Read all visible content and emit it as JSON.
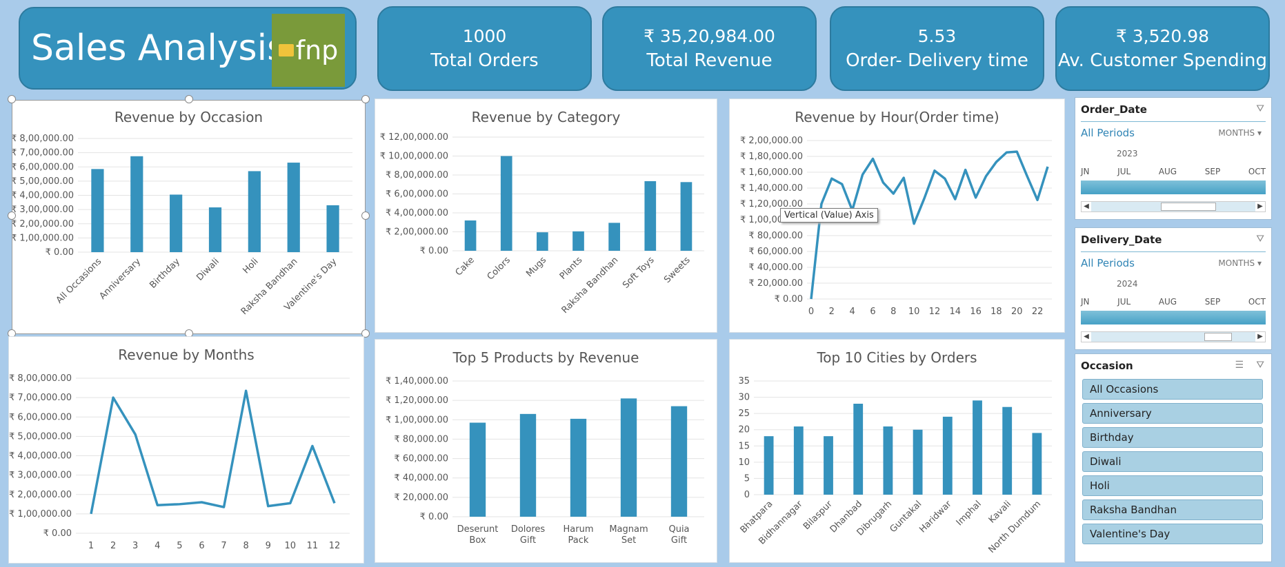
{
  "header": {
    "title": "Sales Analysis",
    "logo_text": "fnp"
  },
  "kpis": [
    {
      "value": "1000",
      "label": "Total Orders"
    },
    {
      "value": "₹ 35,20,984.00",
      "label": "Total Revenue"
    },
    {
      "value": "5.53",
      "label": "Order- Delivery time"
    },
    {
      "value": "₹ 3,520.98",
      "label": "Av. Customer Spending"
    }
  ],
  "tooltip": "Vertical (Value) Axis",
  "slicers": {
    "order_date": {
      "title": "Order_Date",
      "period": "All Periods",
      "unit": "MONTHS",
      "year": "2023",
      "months": [
        "JN",
        "JUL",
        "AUG",
        "SEP",
        "OCT"
      ]
    },
    "delivery_date": {
      "title": "Delivery_Date",
      "period": "All Periods",
      "unit": "MONTHS",
      "year": "2024",
      "months": [
        "JN",
        "JUL",
        "AUG",
        "SEP",
        "OCT"
      ]
    },
    "occasion": {
      "title": "Occasion",
      "items": [
        "All Occasions",
        "Anniversary",
        "Birthday",
        "Diwali",
        "Holi",
        "Raksha Bandhan",
        "Valentine's Day"
      ]
    }
  },
  "colors": {
    "accent": "#3592bd",
    "background": "#a9cbea"
  },
  "chart_data": [
    {
      "id": "occasion",
      "type": "bar",
      "title": "Revenue by Occasion",
      "categories": [
        "All Occasions",
        "Anniversary",
        "Birthday",
        "Diwali",
        "Holi",
        "Raksha Bandhan",
        "Valentine's Day"
      ],
      "values": [
        585000,
        675000,
        405000,
        315000,
        570000,
        630000,
        330000
      ],
      "ylim": [
        0,
        800000
      ],
      "yticks": [
        "₹ 0.00",
        "₹ 1,00,000.00",
        "₹ 2,00,000.00",
        "₹ 3,00,000.00",
        "₹ 4,00,000.00",
        "₹ 5,00,000.00",
        "₹ 6,00,000.00",
        "₹ 7,00,000.00",
        "₹ 8,00,000.00"
      ]
    },
    {
      "id": "category",
      "type": "bar",
      "title": "Revenue by Category",
      "categories": [
        "Cake",
        "Colors",
        "Mugs",
        "Plants",
        "Raksha Bandhan",
        "Soft Toys",
        "Sweets"
      ],
      "values": [
        320000,
        1000000,
        195000,
        205000,
        295000,
        735000,
        725000
      ],
      "ylim": [
        0,
        1200000
      ],
      "yticks": [
        "₹ 0.00",
        "₹ 2,00,000.00",
        "₹ 4,00,000.00",
        "₹ 6,00,000.00",
        "₹ 8,00,000.00",
        "₹ 10,00,000.00",
        "₹ 12,00,000.00"
      ]
    },
    {
      "id": "hour",
      "type": "line",
      "title": "Revenue by Hour(Order time)",
      "x": [
        0,
        1,
        2,
        3,
        4,
        5,
        6,
        7,
        8,
        9,
        10,
        11,
        12,
        13,
        14,
        15,
        16,
        17,
        18,
        19,
        20,
        21,
        22,
        23
      ],
      "values": [
        0,
        120000,
        152000,
        145000,
        112000,
        157000,
        177000,
        147000,
        133000,
        153000,
        95000,
        127000,
        162000,
        152000,
        126000,
        163000,
        128000,
        155000,
        173000,
        185000,
        186000,
        155000,
        125000,
        167000
      ],
      "xticks": [
        "0",
        "2",
        "4",
        "6",
        "8",
        "10",
        "12",
        "14",
        "16",
        "18",
        "20",
        "22"
      ],
      "ylim": [
        0,
        200000
      ],
      "yticks": [
        "₹ 0.00",
        "₹ 20,000.00",
        "₹ 40,000.00",
        "₹ 60,000.00",
        "₹ 80,000.00",
        "₹ 1,00,000.00",
        "₹ 1,20,000.00",
        "₹ 1,40,000.00",
        "₹ 1,60,000.00",
        "₹ 1,80,000.00",
        "₹ 2,00,000.00"
      ]
    },
    {
      "id": "months",
      "type": "line",
      "title": "Revenue by Months",
      "x": [
        1,
        2,
        3,
        4,
        5,
        6,
        7,
        8,
        9,
        10,
        11,
        12
      ],
      "values": [
        100000,
        700000,
        510000,
        145000,
        150000,
        160000,
        135000,
        735000,
        140000,
        155000,
        450000,
        155000
      ],
      "xticks": [
        "1",
        "2",
        "3",
        "4",
        "5",
        "6",
        "7",
        "8",
        "9",
        "10",
        "11",
        "12"
      ],
      "ylim": [
        0,
        800000
      ],
      "yticks": [
        "₹ 0.00",
        "₹ 1,00,000.00",
        "₹ 2,00,000.00",
        "₹ 3,00,000.00",
        "₹ 4,00,000.00",
        "₹ 5,00,000.00",
        "₹ 6,00,000.00",
        "₹ 7,00,000.00",
        "₹ 8,00,000.00"
      ]
    },
    {
      "id": "products",
      "type": "bar",
      "title": "Top 5 Products by Revenue",
      "categories": [
        "Deserunt Box",
        "Dolores Gift",
        "Harum Pack",
        "Magnam Set",
        "Quia Gift"
      ],
      "values": [
        97000,
        106000,
        101000,
        122000,
        114000
      ],
      "ylim": [
        0,
        140000
      ],
      "yticks": [
        "₹ 0.00",
        "₹ 20,000.00",
        "₹ 40,000.00",
        "₹ 60,000.00",
        "₹ 80,000.00",
        "₹ 1,00,000.00",
        "₹ 1,20,000.00",
        "₹ 1,40,000.00"
      ]
    },
    {
      "id": "cities",
      "type": "bar",
      "title": "Top 10 Cities by Orders",
      "categories": [
        "Bhatpara",
        "Bidhannagar",
        "Bilaspur",
        "Dhanbad",
        "Dibrugarh",
        "Guntakal",
        "Haridwar",
        "Imphal",
        "Kavali",
        "North Dumdum"
      ],
      "values": [
        18,
        21,
        18,
        28,
        21,
        20,
        24,
        29,
        27,
        19
      ],
      "ylim": [
        0,
        35
      ],
      "yticks": [
        "0",
        "5",
        "10",
        "15",
        "20",
        "25",
        "30",
        "35"
      ]
    }
  ]
}
